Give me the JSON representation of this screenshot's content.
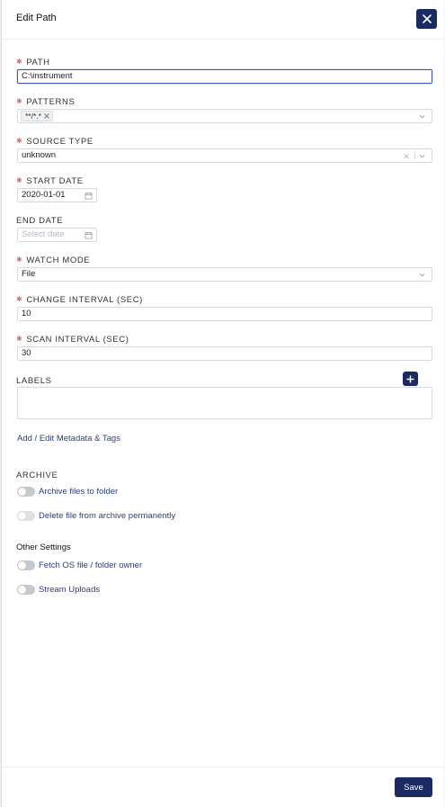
{
  "header": {
    "title": "Edit Path",
    "close_icon": "close-icon"
  },
  "fields": {
    "path": {
      "label": "PATH",
      "value": "C:\\instrument",
      "required": true
    },
    "patterns": {
      "label": "PATTERNS",
      "tags": [
        "**/*.*"
      ],
      "required": true
    },
    "source_type": {
      "label": "SOURCE TYPE",
      "value": "unknown",
      "required": true
    },
    "start_date": {
      "label": "START DATE",
      "value": "2020-01-01",
      "required": true
    },
    "end_date": {
      "label": "END DATE",
      "placeholder": "Select date",
      "required": false
    },
    "watch_mode": {
      "label": "WATCH MODE",
      "value": "File",
      "required": true
    },
    "change_interval": {
      "label": "CHANGE INTERVAL (SEC)",
      "value": "10",
      "required": true
    },
    "scan_interval": {
      "label": "SCAN INTERVAL (SEC)",
      "value": "30",
      "required": true
    },
    "labels": {
      "label": "LABELS"
    }
  },
  "metadata_link": "Add / Edit Metadata & Tags",
  "archive": {
    "title": "ARCHIVE",
    "options": [
      {
        "label": "Archive files to folder",
        "enabled": false
      },
      {
        "label": "Delete file from archive permanently",
        "enabled": false
      }
    ]
  },
  "other_settings": {
    "title": "Other Settings",
    "options": [
      {
        "label": "Fetch OS file / folder owner",
        "enabled": false
      },
      {
        "label": "Stream Uploads",
        "enabled": false
      }
    ]
  },
  "footer": {
    "save_label": "Save"
  },
  "colors": {
    "primary": "#1c2a63",
    "required": "#e06a6a",
    "link": "#2d3f7a"
  }
}
